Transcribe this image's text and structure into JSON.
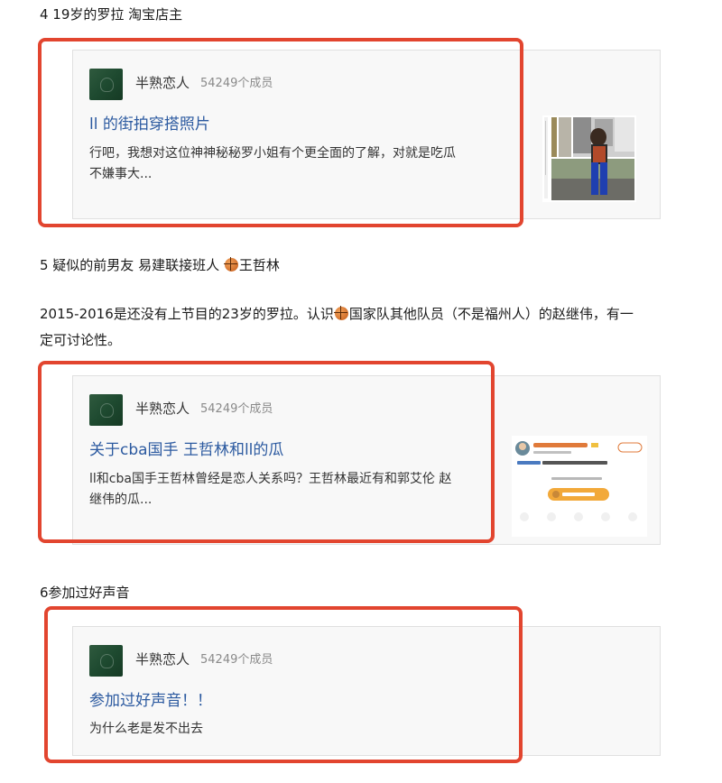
{
  "sections": [
    {
      "heading": "4 19岁的罗拉 淘宝店主",
      "card": {
        "group_name": "半熟恋人",
        "members": "54249个成员",
        "post_title": "ll 的街拍穿搭照片",
        "post_desc_line1": "行吧，我想对这位神神秘秘罗小姐有个更全面的了解，对就是吃瓜",
        "post_desc_line2": "不嫌事大..."
      }
    },
    {
      "heading_text": "5 疑似的前男友 易建联接班人",
      "heading_icon": "basketball-icon",
      "heading_name": "王哲林",
      "paragraph_a": "2015-2016是还没有上节目的23岁的罗拉。认识",
      "paragraph_icon": "basketball-icon",
      "paragraph_b": "国家队其他队员（不是福州人）的赵继伟，有一",
      "paragraph_c": "定可讨论性。",
      "card": {
        "group_name": "半熟恋人",
        "members": "54249个成员",
        "post_title": "关于cba国手 王哲林和ll的瓜",
        "post_desc_line1": "ll和cba国手王哲林曾经是恋人关系吗？王哲林最近有和郭艾伦 赵",
        "post_desc_line2": "继伟的瓜..."
      }
    },
    {
      "heading": "6参加过好声音",
      "card": {
        "group_name": "半熟恋人",
        "members": "54249个成员",
        "post_title": "参加过好声音！！",
        "post_desc_line1": "为什么老是发不出去"
      }
    }
  ],
  "colors": {
    "highlight": "#e2452f",
    "link_blue": "#2c5aa0",
    "card_bg": "#f8f8f8"
  }
}
